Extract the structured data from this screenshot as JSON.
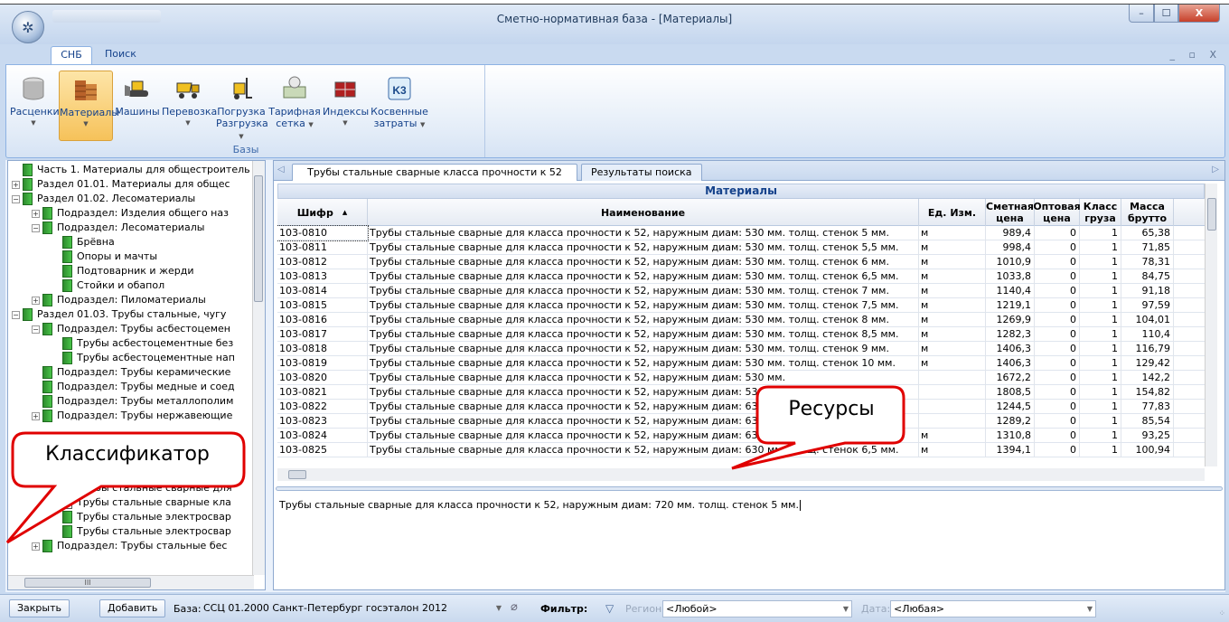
{
  "window": {
    "title": "Сметно-нормативная база - [Материалы]",
    "minimize": "–",
    "maximize": "☐",
    "close": "X",
    "mdi_controls": "_ ▫ X"
  },
  "ribbon": {
    "tabs": [
      {
        "label": "СНБ"
      },
      {
        "label": "Поиск"
      }
    ],
    "group_label": "Базы",
    "buttons": [
      {
        "label": "Расценки",
        "icon": "cylinder-icon"
      },
      {
        "label": "Материалы",
        "icon": "bricks-icon"
      },
      {
        "label": "Машины",
        "icon": "bulldozer-icon"
      },
      {
        "label": "Перевозка",
        "icon": "dump-truck-icon"
      },
      {
        "label": "Погрузка Разгрузка",
        "line1": "Погрузка",
        "line2": "Разгрузка",
        "icon": "forklift-icon"
      },
      {
        "label": "Тарифная сетка",
        "line1": "Тарифная",
        "line2": "сетка",
        "icon": "money-icon"
      },
      {
        "label": "Индексы",
        "icon": "index-chart-icon"
      },
      {
        "label": "Косвенные затраты",
        "line1": "Косвенные",
        "line2": "затраты",
        "icon": "k3-icon"
      }
    ]
  },
  "tree": {
    "items": [
      {
        "text": "Часть 1. Материалы для общестроитель",
        "level": 0,
        "expander": ""
      },
      {
        "text": "Раздел 01.01. Материалы для общес",
        "level": 0,
        "expander": "+"
      },
      {
        "text": "Раздел 01.02. Лесоматериалы",
        "level": 0,
        "expander": "−"
      },
      {
        "text": "Подраздел: Изделия общего наз",
        "level": 1,
        "expander": "+"
      },
      {
        "text": "Подраздел: Лесоматериалы",
        "level": 1,
        "expander": "−"
      },
      {
        "text": "Брёвна",
        "level": 2,
        "expander": ""
      },
      {
        "text": "Опоры и мачты",
        "level": 2,
        "expander": ""
      },
      {
        "text": "Подтоварник и жерди",
        "level": 2,
        "expander": ""
      },
      {
        "text": "Стойки и обапол",
        "level": 2,
        "expander": ""
      },
      {
        "text": "Подраздел: Пиломатериалы",
        "level": 1,
        "expander": "+"
      },
      {
        "text": "Раздел 01.03. Трубы стальные, чугу",
        "level": 0,
        "expander": "−"
      },
      {
        "text": "Подраздел: Трубы асбестоцемен",
        "level": 1,
        "expander": "−"
      },
      {
        "text": "Трубы асбестоцементные без",
        "level": 2,
        "expander": ""
      },
      {
        "text": "Трубы асбестоцементные нап",
        "level": 2,
        "expander": ""
      },
      {
        "text": "Подраздел: Трубы керамические",
        "level": 1,
        "expander": ""
      },
      {
        "text": "Подраздел: Трубы медные и соед",
        "level": 1,
        "expander": ""
      },
      {
        "text": "Подраздел: Трубы металлополим",
        "level": 1,
        "expander": ""
      },
      {
        "text": "Подраздел: Трубы нержавеющие",
        "level": 1,
        "expander": "+"
      },
      {
        "text": "",
        "level": 2,
        "expander": ""
      },
      {
        "text": "",
        "level": 2,
        "expander": ""
      },
      {
        "text": "",
        "level": 2,
        "expander": ""
      },
      {
        "text": "",
        "level": 2,
        "expander": ""
      },
      {
        "text": "Трубы стальные сварные для",
        "level": 2,
        "expander": ""
      },
      {
        "text": "Трубы стальные сварные кла",
        "level": 2,
        "expander": "",
        "open": true
      },
      {
        "text": "Трубы стальные электросвар",
        "level": 2,
        "expander": ""
      },
      {
        "text": "Трубы стальные электросвар",
        "level": 2,
        "expander": ""
      },
      {
        "text": "Подраздел: Трубы стальные бес",
        "level": 1,
        "expander": "+"
      }
    ],
    "hscroll_thumb": "III"
  },
  "doc_tabs": [
    {
      "label": "Трубы стальные сварные класса прочности к 52"
    },
    {
      "label": "Результаты поиска"
    }
  ],
  "grid": {
    "caption": "Материалы",
    "columns": [
      "Шифр",
      "Наименование",
      "Ед. Изм.",
      "Сметная цена",
      "Оптовая цена",
      "Класс груза",
      "Масса брутто"
    ],
    "rows": [
      [
        "103-0810",
        "Трубы стальные сварные для класса прочности к 52, наружным диам: 530 мм. толщ. стенок 5 мм.",
        "м",
        "989,4",
        "0",
        "1",
        "65,38"
      ],
      [
        "103-0811",
        "Трубы стальные сварные для класса прочности к 52, наружным диам: 530 мм. толщ. стенок 5,5 мм.",
        "м",
        "998,4",
        "0",
        "1",
        "71,85"
      ],
      [
        "103-0812",
        "Трубы стальные сварные для класса прочности к 52, наружным диам: 530 мм. толщ. стенок 6 мм.",
        "м",
        "1010,9",
        "0",
        "1",
        "78,31"
      ],
      [
        "103-0813",
        "Трубы стальные сварные для класса прочности к 52, наружным диам: 530 мм. толщ. стенок 6,5 мм.",
        "м",
        "1033,8",
        "0",
        "1",
        "84,75"
      ],
      [
        "103-0814",
        "Трубы стальные сварные для класса прочности к 52, наружным диам: 530 мм. толщ. стенок 7 мм.",
        "м",
        "1140,4",
        "0",
        "1",
        "91,18"
      ],
      [
        "103-0815",
        "Трубы стальные сварные для класса прочности к 52, наружным диам: 530 мм. толщ. стенок 7,5 мм.",
        "м",
        "1219,1",
        "0",
        "1",
        "97,59"
      ],
      [
        "103-0816",
        "Трубы стальные сварные для класса прочности к 52, наружным диам: 530 мм. толщ. стенок 8 мм.",
        "м",
        "1269,9",
        "0",
        "1",
        "104,01"
      ],
      [
        "103-0817",
        "Трубы стальные сварные для класса прочности к 52, наружным диам: 530 мм. толщ. стенок 8,5 мм.",
        "м",
        "1282,3",
        "0",
        "1",
        "110,4"
      ],
      [
        "103-0818",
        "Трубы стальные сварные для класса прочности к 52, наружным диам: 530 мм. толщ. стенок 9 мм.",
        "м",
        "1406,3",
        "0",
        "1",
        "116,79"
      ],
      [
        "103-0819",
        "Трубы стальные сварные для класса прочности к 52, наружным диам: 530 мм. толщ. стенок 10 мм.",
        "м",
        "1406,3",
        "0",
        "1",
        "129,42"
      ],
      [
        "103-0820",
        "Трубы стальные сварные для класса прочности к 52, наружным диам: 530 мм.",
        "",
        "1672,2",
        "0",
        "1",
        "142,2"
      ],
      [
        "103-0821",
        "Трубы стальные сварные для класса прочности к 52, наружным диам: 530 мм.",
        "",
        "1808,5",
        "0",
        "1",
        "154,82"
      ],
      [
        "103-0822",
        "Трубы стальные сварные для класса прочности к 52, наружным диам: 630 мм.",
        "",
        "1244,5",
        "0",
        "1",
        "77,83"
      ],
      [
        "103-0823",
        "Трубы стальные сварные для класса прочности к 52, наружным диам: 630 мм.",
        "",
        "1289,2",
        "0",
        "1",
        "85,54"
      ],
      [
        "103-0824",
        "Трубы стальные сварные для класса прочности к 52, наружным диам: 630 мм. толщ.",
        "м",
        "1310,8",
        "0",
        "1",
        "93,25"
      ],
      [
        "103-0825",
        "Трубы стальные сварные для класса прочности к 52, наружным диам: 630 мм. толщ. стенок 6,5 мм.",
        "м",
        "1394,1",
        "0",
        "1",
        "100,94"
      ]
    ]
  },
  "description": "Трубы стальные сварные для класса прочности к 52, наружным диам: 720 мм. толщ. стенок 5 мм.",
  "callouts": {
    "classifier": "Классификатор",
    "resources": "Ресурсы",
    "color": "#e00000"
  },
  "statusbar": {
    "close_label": "Закрыть",
    "add_label": "Добавить",
    "base_label": "База:",
    "base_value": "ССЦ 01.2000 Санкт-Петербург госэталон 2012",
    "filter_label": "Фильтр:",
    "region_label": "Регион:",
    "region_value": "<Любой>",
    "date_label": "Дата:",
    "date_value": "<Любая>"
  },
  "colors": {
    "ribbon_text": "#15428b",
    "active_button": "#f6c25a",
    "tree_book": "#49c449"
  }
}
